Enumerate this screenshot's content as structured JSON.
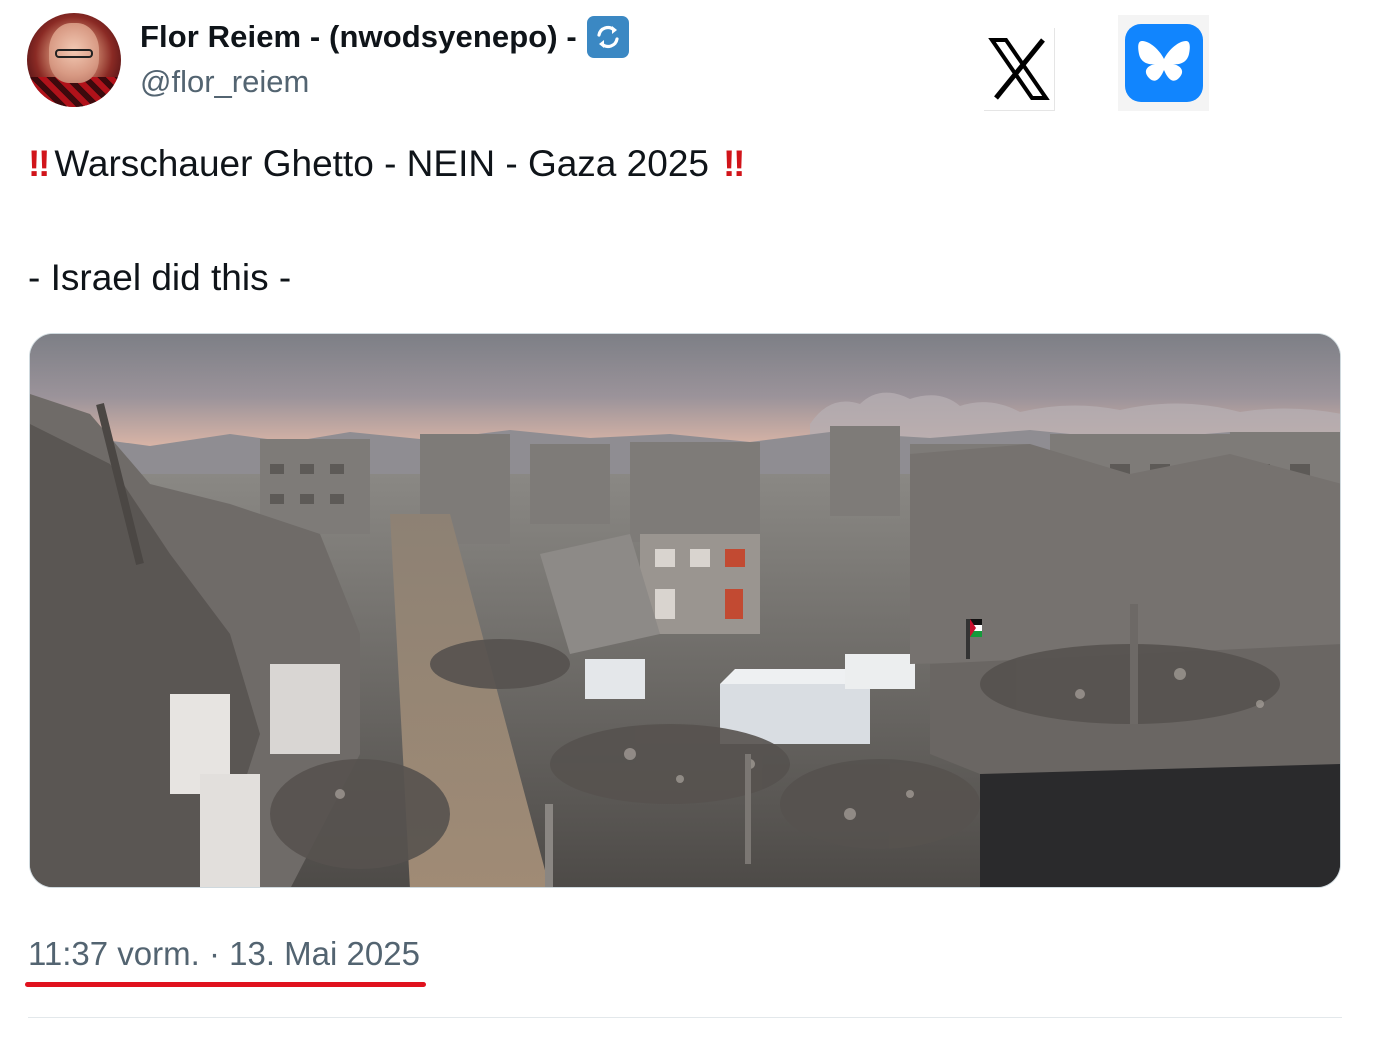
{
  "author": {
    "display_name": "Flor Reiem - (nwodsyenepo) -",
    "handle": "@flor_reiem"
  },
  "icons": {
    "avatar": "profile-photo",
    "badge": "repeat-arrows-icon",
    "platform_1": "x-logo-icon",
    "platform_2": "bluesky-butterfly-icon"
  },
  "tweet": {
    "emphasis_mark": "‼",
    "line1_text": "Warschauer Ghetto - NEIN - Gaza 2025",
    "line2_text": "- Israel did this -"
  },
  "meta": {
    "timestamp": "11:37 vorm. · 13. Mai 2025"
  },
  "colors": {
    "text": "#0f1419",
    "secondary": "#536471",
    "accent_red": "#e0121e",
    "badge_blue": "#3b88c3",
    "bluesky_blue": "#1185fe"
  }
}
